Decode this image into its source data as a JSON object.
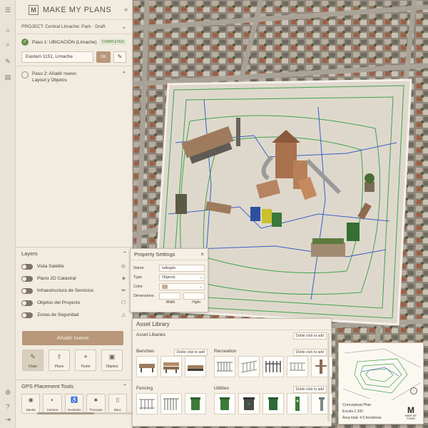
{
  "app": {
    "name": "MAKE MY PLANS",
    "logo_letter": "M"
  },
  "project": {
    "label": "PROJECT: Central Limache: Park · Draft"
  },
  "rail_icons": [
    "menu-icon",
    "home-icon",
    "search-icon",
    "edit-icon",
    "layers-icon"
  ],
  "step1": {
    "title": "Paso 1: UBICACIÓN (Limache)",
    "badge": "COMPLETED",
    "address": "Eastam 1151, Limache",
    "ok_label": "OK"
  },
  "step2": {
    "title_line1": "Paso 2: Añadir nuevo",
    "title_line2": "Layout y Objetos"
  },
  "layers": {
    "title": "Layers",
    "items": [
      {
        "label": "Vista Satélite",
        "on": true
      },
      {
        "label": "Plano 2D Catastral",
        "on": true
      },
      {
        "label": "Infraestructura de Servicios",
        "on": true
      },
      {
        "label": "Objetos del Proyecto",
        "on": true
      },
      {
        "label": "Zonas de Seguridad",
        "on": true
      }
    ]
  },
  "add_button": "Añadir nuevo",
  "tools": [
    {
      "label": "Draw",
      "icon": "pen-icon"
    },
    {
      "label": "Place",
      "icon": "upload-icon"
    },
    {
      "label": "Punto",
      "icon": "pin-icon"
    },
    {
      "label": "Objetos",
      "icon": "objects-icon"
    }
  ],
  "gps": {
    "title": "GPS Placement Tools",
    "items": [
      {
        "label": "Banita"
      },
      {
        "label": "Camera"
      },
      {
        "label": "Invasidos"
      },
      {
        "label": "Treceyas"
      },
      {
        "label": "Basc"
      }
    ]
  },
  "property_settings": {
    "title": "Property Settings",
    "name_label": "Name",
    "name_value": "tallegán",
    "type_label": "Type",
    "type_value": "Objects",
    "color_label": "Color",
    "dims_label": "Dimensions",
    "width_caption": "Width",
    "height_caption": "Hight"
  },
  "asset_library": {
    "title": "Asset Library",
    "subtitle": "Asset Libaries",
    "hint": "Doble click to add",
    "categories": [
      {
        "name": "Benches",
        "hint": "Doble click to add"
      },
      {
        "name": "Recreation",
        "hint": "Doble click to add"
      },
      {
        "name": "Fencing",
        "hint": "Doble click to add"
      },
      {
        "name": "Utilities",
        "hint": "Doble click to add"
      }
    ]
  },
  "plan_card": {
    "title": "Conceptual Plan",
    "scale": "Escala 1:100",
    "area": "Área total: 4.5 hectáreas",
    "logo_text": "MAKE MY PLANS"
  },
  "colors": {
    "panel_bg": "#f1ebe0",
    "accent": "#b8977a",
    "success": "#6b8f4a",
    "path_green": "#3fa34d",
    "path_blue": "#3a5fc8"
  }
}
